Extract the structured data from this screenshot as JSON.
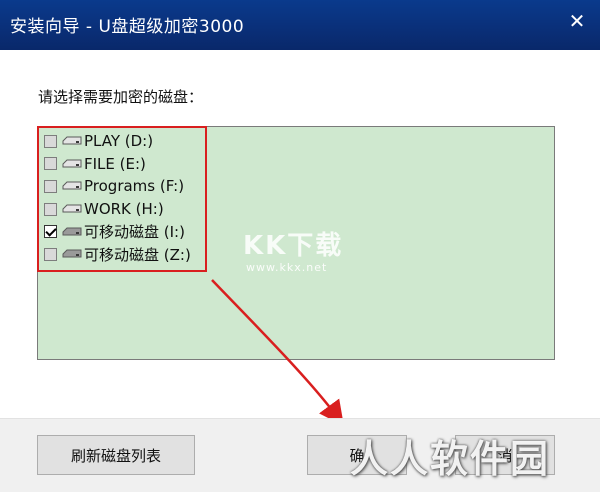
{
  "window": {
    "title": "安装向导 - U盘超级加密3000",
    "close_glyph": "✕"
  },
  "prompt": "请选择需要加密的磁盘：",
  "disks": [
    {
      "label": "PLAY (D:)",
      "checked": false,
      "icon": "hard-drive-icon"
    },
    {
      "label": "FILE (E:)",
      "checked": false,
      "icon": "hard-drive-icon"
    },
    {
      "label": "Programs (F:)",
      "checked": false,
      "icon": "hard-drive-icon"
    },
    {
      "label": "WORK (H:)",
      "checked": false,
      "icon": "hard-drive-icon"
    },
    {
      "label": "可移动磁盘 (I:)",
      "checked": true,
      "icon": "removable-drive-icon"
    },
    {
      "label": "可移动磁盘 (Z:)",
      "checked": false,
      "icon": "removable-drive-icon"
    }
  ],
  "watermark": {
    "text": "KK下载",
    "url": "www.kkx.net"
  },
  "corner_watermark": "人人软件园",
  "buttons": {
    "refresh": "刷新磁盘列表",
    "ok": "确",
    "cancel": "消"
  },
  "colors": {
    "titlebar": "#0a3a8c",
    "panel": "#cfe8cf",
    "highlight": "#d91f1f"
  }
}
